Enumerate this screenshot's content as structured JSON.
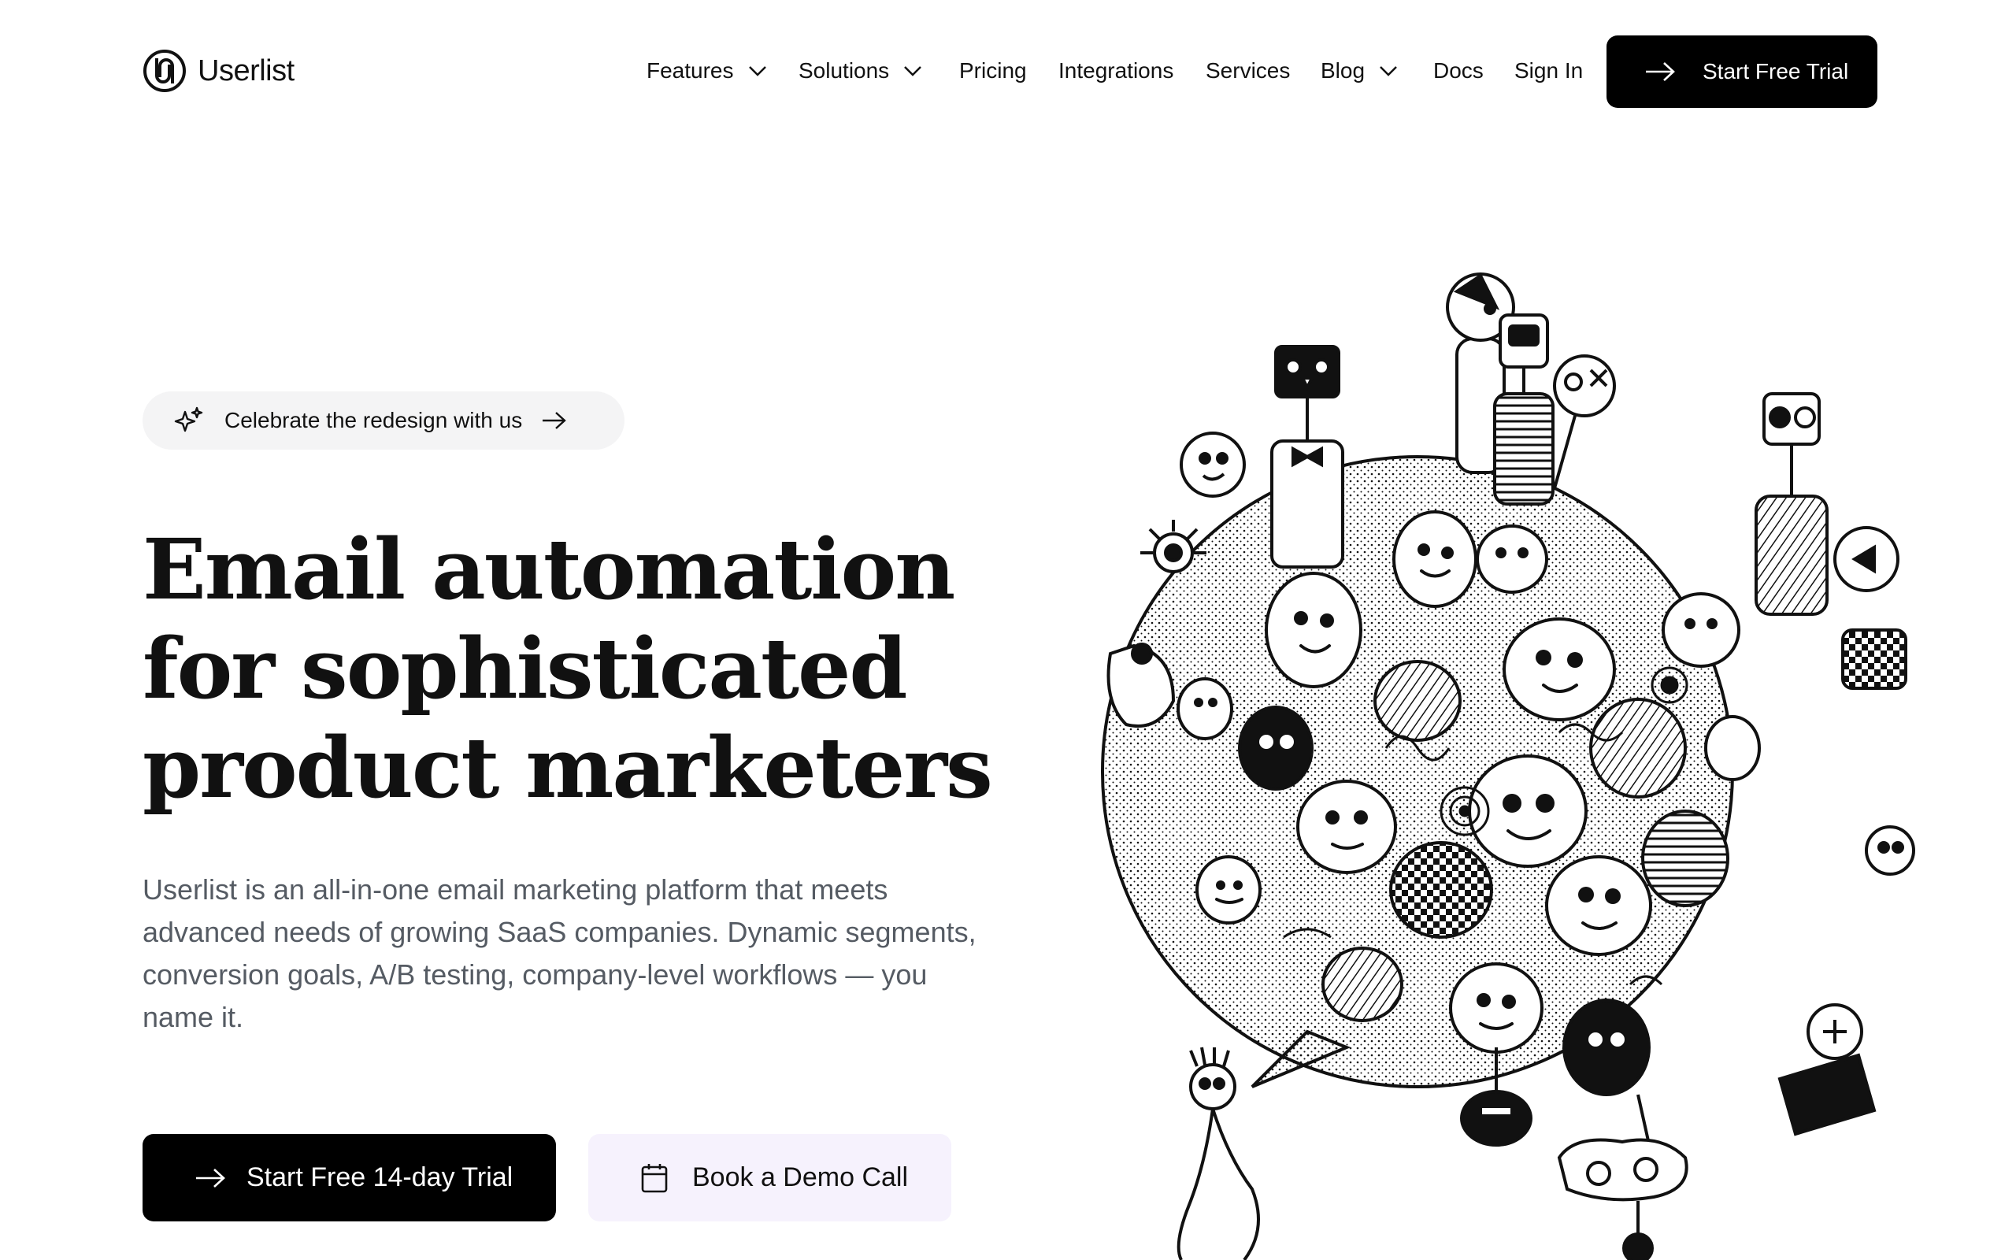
{
  "brand": {
    "name": "Userlist"
  },
  "nav": {
    "items": [
      {
        "label": "Features",
        "has_dropdown": true
      },
      {
        "label": "Solutions",
        "has_dropdown": true
      },
      {
        "label": "Pricing",
        "has_dropdown": false
      },
      {
        "label": "Integrations",
        "has_dropdown": false
      },
      {
        "label": "Services",
        "has_dropdown": false
      },
      {
        "label": "Blog",
        "has_dropdown": true
      },
      {
        "label": "Docs",
        "has_dropdown": false
      }
    ],
    "sign_in": "Sign In",
    "cta": "Start Free Trial"
  },
  "hero": {
    "badge": "Celebrate the redesign with us",
    "headline": [
      "Email automation",
      "for sophisticated",
      "product marketers"
    ],
    "subtitle": "Userlist is an all-in-one email marketing platform that meets advanced needs of growing SaaS companies. Dynamic segments, conversion goals, A/B testing, company-level workflows — you name it.",
    "primary_cta": "Start Free 14-day Trial",
    "secondary_cta": "Book a Demo Call",
    "illustration": "doodle-crowd-speech-bubble"
  },
  "colors": {
    "text": "#111111",
    "muted": "#555b63",
    "button_dark": "#000000",
    "button_light": "#f6f2fd",
    "badge_bg": "#f4f4f5"
  }
}
